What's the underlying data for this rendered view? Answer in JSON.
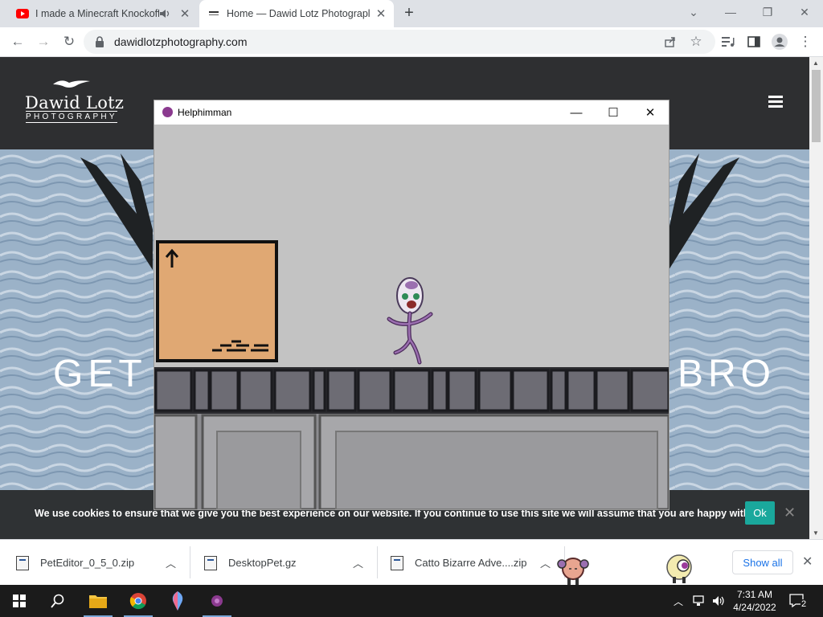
{
  "browser": {
    "tabs": [
      {
        "title": "I made a Minecraft Knockoff",
        "favicon": "youtube-icon",
        "playing_audio": true
      },
      {
        "title": "Home — Dawid Lotz Photograpl",
        "favicon": "site-favicon",
        "active": true
      }
    ],
    "new_tab": "+",
    "url": "dawidlotzphotography.com",
    "window_controls": {
      "minimize": "—",
      "restore": "❐",
      "close": "✕",
      "tab_search": "⌄"
    },
    "nav_icons": {
      "back": "←",
      "forward": "→",
      "reload": "↻"
    }
  },
  "site": {
    "logo_name": "Dawid Lotz",
    "logo_sub": "PHOTOGRAPHY",
    "hero_left": "GET",
    "hero_right": "BRO",
    "cookie_text": "We use cookies to ensure that we give you the best experience on our website. If you continue to use this site we will assume that you are happy with it.",
    "cookie_ok": "Ok",
    "cookie_close": "✕"
  },
  "game": {
    "title": "Helphimman",
    "controls": {
      "minimize": "—",
      "maximize": "☐",
      "close": "✕"
    },
    "background": "#c3c3c3",
    "crate_color": "#e0a873",
    "stone_color": "#6d6c74"
  },
  "downloads": {
    "items": [
      {
        "name": "PetEditor_0_5_0.zip"
      },
      {
        "name": "DesktopPet.gz"
      },
      {
        "name": "Catto Bizarre Adve....zip"
      }
    ],
    "show_all": "Show all",
    "close": "✕"
  },
  "taskbar": {
    "time": "7:31 AM",
    "date": "4/24/2022",
    "notification_count": "2",
    "accent": "#7aa7d8"
  }
}
